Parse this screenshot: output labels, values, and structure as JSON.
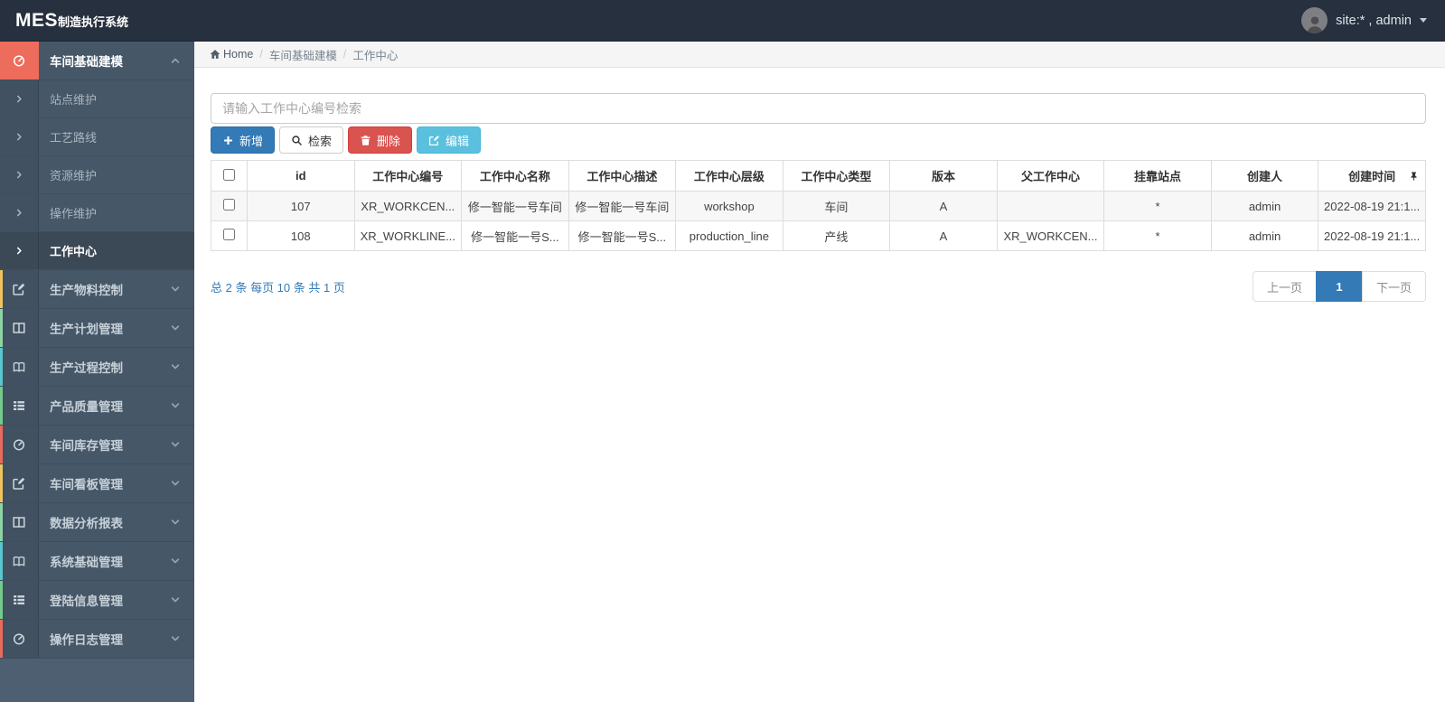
{
  "topbar": {
    "brand_bold": "MES",
    "brand_rest": "制造执行系统",
    "user": "site:* , admin"
  },
  "breadcrumb": {
    "home": "Home",
    "separator": "/",
    "items": [
      "车间基础建模",
      "工作中心"
    ]
  },
  "sidebar": {
    "items": [
      {
        "label": "车间基础建模",
        "icon": "gauge-icon",
        "accent": "#ee6c5b",
        "expanded": true,
        "children": [
          {
            "label": "站点维护",
            "active": false
          },
          {
            "label": "工艺路线",
            "active": false
          },
          {
            "label": "资源维护",
            "active": false
          },
          {
            "label": "操作维护",
            "active": false
          },
          {
            "label": "工作中心",
            "active": true
          }
        ]
      },
      {
        "label": "生产物料控制",
        "icon": "pencil-square-icon",
        "accent": "#eec35e",
        "expanded": false
      },
      {
        "label": "生产计划管理",
        "icon": "columns-icon",
        "accent": "#8ed3a3",
        "expanded": false
      },
      {
        "label": "生产过程控制",
        "icon": "book-icon",
        "accent": "#58c7cf",
        "expanded": false
      },
      {
        "label": "产品质量管理",
        "icon": "list-icon",
        "accent": "#74cb8c",
        "expanded": false
      },
      {
        "label": "车间库存管理",
        "icon": "gauge-icon",
        "accent": "#e96a5e",
        "expanded": false
      },
      {
        "label": "车间看板管理",
        "icon": "pencil-square-icon",
        "accent": "#eec35e",
        "expanded": false
      },
      {
        "label": "数据分析报表",
        "icon": "columns-icon",
        "accent": "#8ed3a3",
        "expanded": false
      },
      {
        "label": "系统基础管理",
        "icon": "book-icon",
        "accent": "#58c7cf",
        "expanded": false
      },
      {
        "label": "登陆信息管理",
        "icon": "list-icon",
        "accent": "#74cb8c",
        "expanded": false
      },
      {
        "label": "操作日志管理",
        "icon": "gauge-icon",
        "accent": "#e96a5e",
        "expanded": false
      }
    ]
  },
  "toolbar": {
    "search_placeholder": "请输入工作中心编号检索",
    "buttons": [
      {
        "label": "新增",
        "icon": "plus-icon",
        "style": "primary"
      },
      {
        "label": "检索",
        "icon": "search-icon",
        "style": "default"
      },
      {
        "label": "删除",
        "icon": "trash-icon",
        "style": "danger"
      },
      {
        "label": "编辑",
        "icon": "edit-icon",
        "style": "info"
      }
    ]
  },
  "table": {
    "columns": [
      "id",
      "工作中心编号",
      "工作中心名称",
      "工作中心描述",
      "工作中心层级",
      "工作中心类型",
      "版本",
      "父工作中心",
      "挂靠站点",
      "创建人",
      "创建时间"
    ],
    "rows": [
      [
        "107",
        "XR_WORKCEN...",
        "修一智能一号车间",
        "修一智能一号车间",
        "workshop",
        "车间",
        "A",
        "",
        "*",
        "admin",
        "2022-08-19 21:1..."
      ],
      [
        "108",
        "XR_WORKLINE...",
        "修一智能一号S...",
        "修一智能一号S...",
        "production_line",
        "产线",
        "A",
        "XR_WORKCEN...",
        "*",
        "admin",
        "2022-08-19 21:1..."
      ]
    ]
  },
  "pagination": {
    "summary": "总 2 条  每页 10 条  共 1 页",
    "prev": "上一页",
    "current": "1",
    "next": "下一页"
  },
  "colors": {
    "topbar_bg": "#26303e",
    "sidebar_bg": "#4d5f70",
    "active_icon_bg": "#ee6c5b",
    "primary": "#337ab7",
    "danger": "#d9534f",
    "info": "#5bc0de"
  }
}
